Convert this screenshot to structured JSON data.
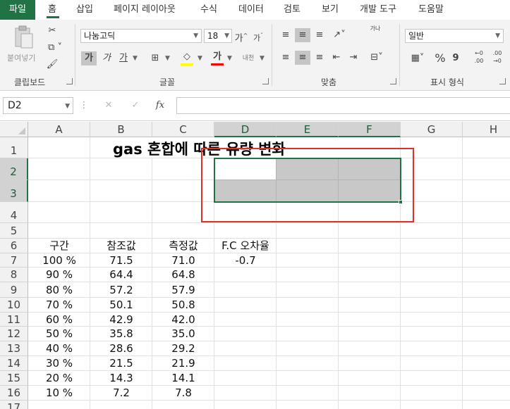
{
  "menu": {
    "tabs": [
      "파일",
      "홈",
      "삽입",
      "페이지 레이아웃",
      "수식",
      "데이터",
      "검토",
      "보기",
      "개발 도구",
      "도움말"
    ]
  },
  "ribbon": {
    "clipboard": {
      "paste_label": "붙여넣기",
      "group_label": "클립보드"
    },
    "font": {
      "font_name": "나눔고딕",
      "font_size": "18",
      "bold_label": "가",
      "italic_label": "가",
      "underline_label": "가",
      "grow_label": "가",
      "shrink_label": "가",
      "fontcolor_label": "가",
      "phonetic_label": "내천",
      "group_label": "글꼴",
      "highlight_color": "#ffff00",
      "font_color": "#ff0000"
    },
    "alignment": {
      "wrap_label": "가나",
      "group_label": "맞춤"
    },
    "number": {
      "format": "일반",
      "percent_label": "%",
      "comma_label": "9",
      "inc_decimal": "←0 .00",
      "dec_decimal": ".00 →0",
      "group_label": "표시 형식"
    }
  },
  "formula_bar": {
    "name_box": "D2",
    "fx_label": "fx",
    "value": ""
  },
  "sheet": {
    "columns": [
      "A",
      "B",
      "C",
      "D",
      "E",
      "F",
      "G",
      "H"
    ],
    "rows": [
      "1",
      "2",
      "3",
      "4",
      "5",
      "6",
      "7",
      "8",
      "9",
      "10",
      "11",
      "12",
      "13",
      "14",
      "15",
      "16",
      "17"
    ],
    "title": "gas 혼합에 따른 유량 변화",
    "headers": [
      "구간",
      "참조값",
      "측정값",
      "F.C 오차율"
    ],
    "data": [
      [
        "100 %",
        "71.5",
        "71.0",
        "-0.7"
      ],
      [
        "90 %",
        "64.4",
        "64.8",
        ""
      ],
      [
        "80 %",
        "57.2",
        "57.9",
        ""
      ],
      [
        "70 %",
        "50.1",
        "50.8",
        ""
      ],
      [
        "60 %",
        "42.9",
        "42.0",
        ""
      ],
      [
        "50 %",
        "35.8",
        "35.0",
        ""
      ],
      [
        "40 %",
        "28.6",
        "29.2",
        ""
      ],
      [
        "30 %",
        "21.5",
        "21.9",
        ""
      ],
      [
        "20 %",
        "14.3",
        "14.1",
        ""
      ],
      [
        "10 %",
        "7.2",
        "7.8",
        ""
      ]
    ],
    "selection_color": "#217346",
    "highlight_box_color": "#e0302a"
  }
}
